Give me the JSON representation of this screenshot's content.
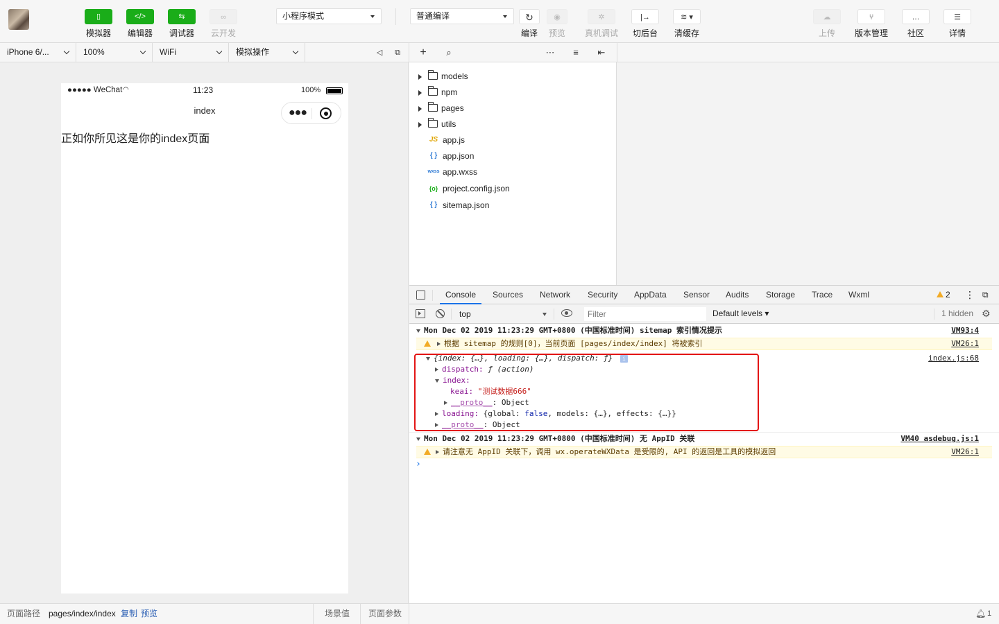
{
  "toolbar": {
    "simulator": "模拟器",
    "editor": "编辑器",
    "debugger": "调试器",
    "cloud": "云开发",
    "mode_select": "小程序模式",
    "compile_select": "普通编译",
    "compile": "编译",
    "preview": "预览",
    "remote_debug": "真机调试",
    "background": "切后台",
    "clear_cache": "清缓存",
    "upload": "上传",
    "version": "版本管理",
    "community": "社区",
    "details": "详情"
  },
  "subbar": {
    "device": "iPhone 6/...",
    "zoom": "100%",
    "network": "WiFi",
    "operation": "模拟操作"
  },
  "phone": {
    "carrier": "●●●●● WeChat",
    "time": "11:23",
    "battery": "100%",
    "title": "index",
    "content": "正如你所见这是你的index页面"
  },
  "footer": {
    "path_label": "页面路径",
    "path": "pages/index/index",
    "copy": "复制",
    "preview": "预览",
    "scene": "场景值",
    "params": "页面参数",
    "notif_count": "1"
  },
  "tree": {
    "folders": [
      "models",
      "npm",
      "pages",
      "utils"
    ],
    "files": [
      {
        "name": "app.js",
        "icon": "JS"
      },
      {
        "name": "app.json",
        "icon": "{ }"
      },
      {
        "name": "app.wxss",
        "icon": "wxss"
      },
      {
        "name": "project.config.json",
        "icon": "{o}"
      },
      {
        "name": "sitemap.json",
        "icon": "{ }"
      }
    ]
  },
  "devtools": {
    "tabs": [
      "Console",
      "Sources",
      "Network",
      "Security",
      "AppData",
      "Sensor",
      "Audits",
      "Storage",
      "Trace",
      "Wxml"
    ],
    "warn_count": "2",
    "context": "top",
    "filter_placeholder": "Filter",
    "levels": "Default levels ▾",
    "hidden": "1 hidden"
  },
  "console": {
    "g1_header": "Mon Dec 02 2019 11:23:29 GMT+0800 (中国标准时间) sitemap 索引情况提示",
    "g1_src": "VM93:4",
    "g1_warn": "根据 sitemap 的规则[0]，当前页面 [pages/index/index] 将被索引",
    "g1_warn_src": "VM26:1",
    "obj_summary": "{index: {…}, loading: {…}, dispatch: ƒ}",
    "obj_src": "index.js:68",
    "dispatch_key": "dispatch:",
    "dispatch_val": "ƒ (action)",
    "index_key": "index:",
    "keai_key": "keai:",
    "keai_val": "\"测试数据666\"",
    "proto_key": "__proto__",
    "proto_val": ": Object",
    "loading_key": "loading:",
    "loading_pre": "{global: ",
    "loading_false": "false",
    "loading_post": ", models: {…}, effects: {…}}",
    "g2_header": "Mon Dec 02 2019 11:23:29 GMT+0800 (中国标准时间) 无 AppID 关联",
    "g2_src": "VM40 asdebug.js:1",
    "g2_warn": "请注意无 AppID 关联下，调用 wx.operateWXData 是受限的, API 的返回是工具的模拟返回",
    "g2_warn_src": "VM26:1",
    "prompt": "›"
  }
}
